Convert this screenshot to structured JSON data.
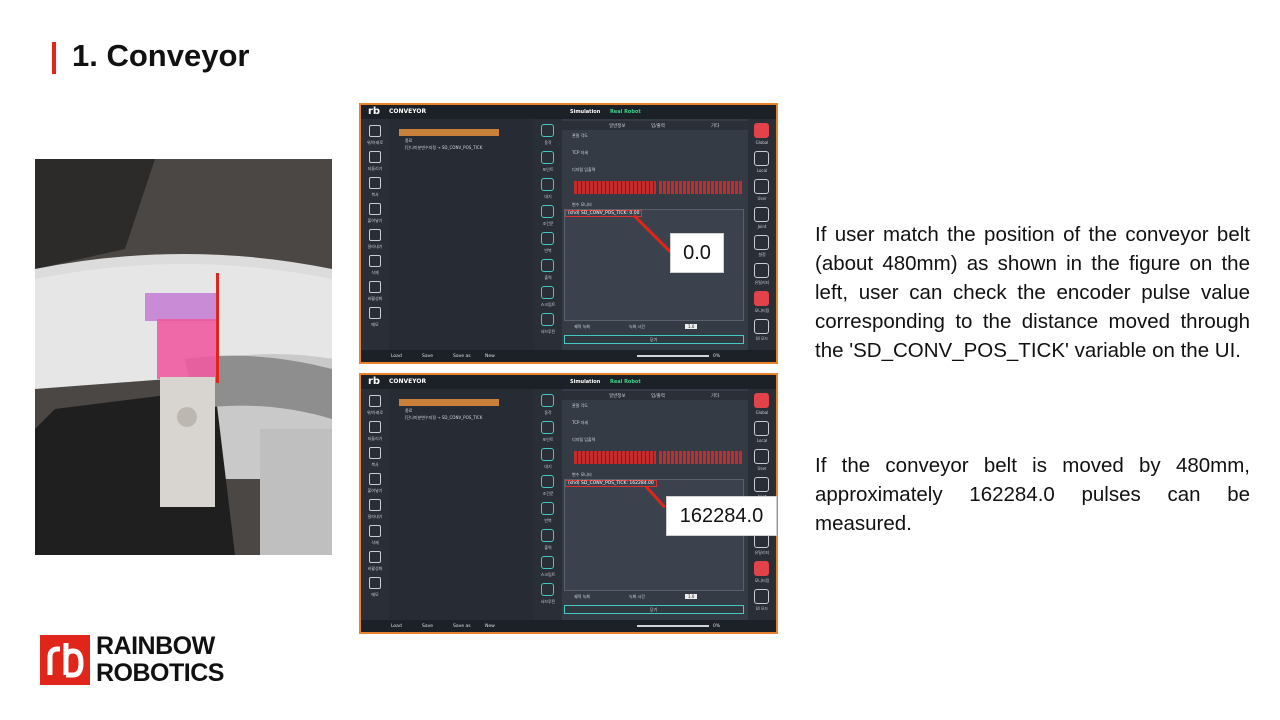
{
  "slide": {
    "title": "1. Conveyor"
  },
  "app": {
    "logo": "rb",
    "name": "CONVEYOR",
    "mode_simulation": "Simulation",
    "mode_real": "Real Robot",
    "tree_line": "[단나미분변수지정 → SD_CONV_POS_TICK",
    "tree_sub": "종료",
    "tabs": [
      "일반정보",
      "입/출력",
      "기타"
    ],
    "joint_label": "관절 각도",
    "tcp_label": "TCP 자세",
    "io_label": "디지털 입출력",
    "var_monitor_label": "변수 모니터",
    "record_label": "궤적 녹화",
    "record_time_label": "녹화 시간",
    "record_time_value": "1.0",
    "close_label": "닫기",
    "progress": "0%",
    "bottom_buttons": [
      "Load",
      "Save",
      "Save as",
      "New"
    ],
    "left_tools": [
      "위/아래로",
      "되돌리기",
      "복사",
      "붙여넣기",
      "잘라내기",
      "삭제",
      "비활성화",
      "메모"
    ],
    "mid_tools": [
      "동작",
      "포인트",
      "대기",
      "조건문",
      "반복",
      "출력",
      "스크립트",
      "서브루틴"
    ],
    "right_tools": [
      "Global",
      "Local",
      "User",
      "Joint",
      "설정",
      "유틸리티",
      "모니터링",
      "UI 모드"
    ]
  },
  "screenshot_top": {
    "var_text": "(shd) SD_CONV_POS_TICK: 0.00",
    "callout_value": "0.0"
  },
  "screenshot_bottom": {
    "var_text": "(shd) SD_CONV_POS_TICK: 162284.00",
    "callout_value": "162284.0"
  },
  "description": {
    "paragraph1": " If user match the position of the conveyor belt (about 480mm) as shown in the figure on the left, user can check the encoder pulse value corresponding to the distance moved through the 'SD_CONV_POS_TICK' variable on the UI.",
    "paragraph2": "If the conveyor belt is moved by 480mm, approximately 162284.0 pulses can be measured."
  },
  "brand": {
    "line1": "RAINBOW",
    "line2": "ROBOTICS"
  },
  "colors": {
    "accent": "#e0261a",
    "app_background": "#2b3038",
    "selection": "#c9803a",
    "teal": "#45c8c4"
  }
}
